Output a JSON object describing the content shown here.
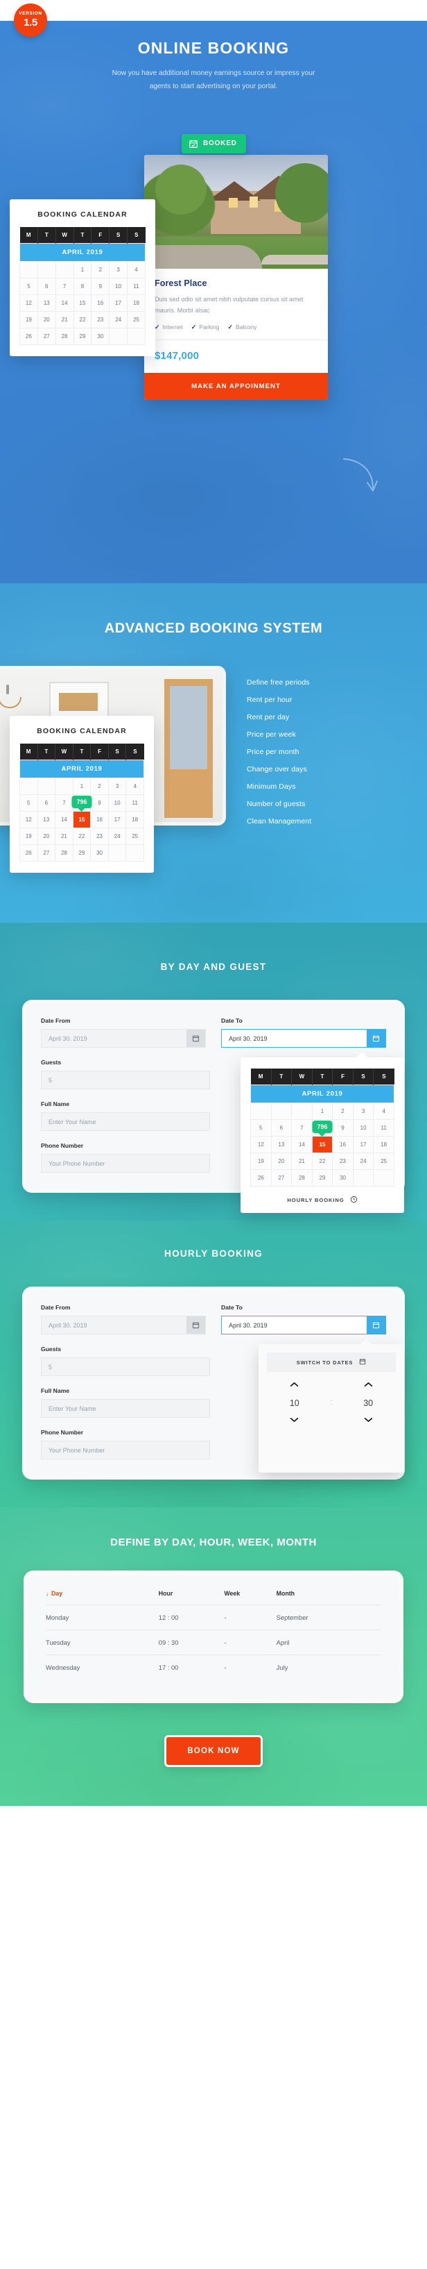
{
  "badge": {
    "label": "VERSION",
    "number": "1.5"
  },
  "hero": {
    "title": "ONLINE BOOKING",
    "subtitle": "Now you have additional money earnings source or impress your agents to start advertising on your portal.",
    "booked_label": "BOOKED",
    "booked_icon": "calendar-check-icon",
    "calendar": {
      "card_title": "BOOKING CALENDAR",
      "month": "APRIL 2019",
      "dow": [
        "M",
        "T",
        "W",
        "T",
        "F",
        "S",
        "S"
      ],
      "weeks": [
        [
          "",
          "",
          "",
          "1",
          "2",
          "3",
          "4"
        ],
        [
          "5",
          "6",
          "7",
          "8",
          "9",
          "10",
          "11"
        ],
        [
          "12",
          "13",
          "14",
          "15",
          "16",
          "17",
          "18"
        ],
        [
          "19",
          "20",
          "21",
          "22",
          "23",
          "24",
          "25"
        ],
        [
          "26",
          "27",
          "28",
          "29",
          "30",
          "",
          ""
        ]
      ]
    },
    "property": {
      "title": "Forest Place",
      "description": "Duis sed odio sit amet nibh vulputate cursus sit amet mauris. Morbi alsac",
      "features": [
        "Internet",
        "Parking",
        "Balcony"
      ],
      "price": "$147,000",
      "cta": "MAKE AN APPOINMENT"
    }
  },
  "advanced": {
    "title": "ADVANCED BOOKING SYSTEM",
    "features": [
      "Define free periods",
      "Rent per hour",
      "Rent per day",
      "Price per week",
      "Price per month",
      "Change over days",
      "Minimum Days",
      "Number of guests",
      "Clean Management"
    ],
    "calendar": {
      "card_title": "BOOKING CALENDAR",
      "month": "APRIL 2019",
      "dow": [
        "M",
        "T",
        "W",
        "T",
        "F",
        "S",
        "S"
      ],
      "weeks": [
        [
          "",
          "",
          "",
          "1",
          "2",
          "3",
          "4"
        ],
        [
          "5",
          "6",
          "7",
          "8",
          "9",
          "10",
          "11"
        ],
        [
          "12",
          "13",
          "14",
          "15",
          "16",
          "17",
          "18"
        ],
        [
          "19",
          "20",
          "21",
          "22",
          "23",
          "24",
          "25"
        ],
        [
          "26",
          "27",
          "28",
          "29",
          "30",
          "",
          ""
        ]
      ],
      "selected_day": "15",
      "price_bubble": "796"
    }
  },
  "byday": {
    "title": "BY DAY AND GUEST",
    "fields": {
      "date_from_label": "Date From",
      "date_from_value": "April 30. 2019",
      "date_to_label": "Date To",
      "date_to_value": "April 30. 2019",
      "guests_label": "Guests",
      "guests_value": "5",
      "fullname_label": "Full Name",
      "fullname_placeholder": "Enter Your Name",
      "phone_label": "Phone Number",
      "phone_placeholder": "Your Phone Number"
    },
    "calendar": {
      "month": "APRIL 2019",
      "dow": [
        "M",
        "T",
        "W",
        "T",
        "F",
        "S",
        "S"
      ],
      "weeks": [
        [
          "",
          "",
          "",
          "1",
          "2",
          "3",
          "4"
        ],
        [
          "5",
          "6",
          "7",
          "8",
          "9",
          "10",
          "11"
        ],
        [
          "12",
          "13",
          "14",
          "15",
          "16",
          "17",
          "18"
        ],
        [
          "19",
          "20",
          "21",
          "22",
          "23",
          "24",
          "25"
        ],
        [
          "26",
          "27",
          "28",
          "29",
          "30",
          "",
          ""
        ]
      ],
      "selected_day": "15",
      "price_bubble": "796",
      "footer_label": "HOURLY BOOKING",
      "footer_icon": "clock-icon"
    }
  },
  "hourly": {
    "title": "HOURLY BOOKING",
    "fields": {
      "date_from_label": "Date From",
      "date_from_value": "April 30. 2019",
      "date_to_label": "Date To",
      "date_to_value": "April 30. 2019",
      "guests_label": "Guests",
      "guests_value": "5",
      "fullname_label": "Full Name",
      "fullname_placeholder": "Enter Your Name",
      "phone_label": "Phone Number",
      "phone_placeholder": "Your Phone Number"
    },
    "picker": {
      "switch_label": "SWITCH TO DATES",
      "switch_icon": "calendar-icon",
      "hours": "10",
      "separator": ":",
      "minutes": "30",
      "up_icon": "chevron-up-icon",
      "down_icon": "chevron-down-icon"
    }
  },
  "define": {
    "title": "DEFINE BY DAY, HOUR, WEEK, MONTH",
    "table": {
      "columns": [
        "Day",
        "Hour",
        "Week",
        "Month"
      ],
      "sorted_column": "Day",
      "sort_icon": "arrow-down-icon",
      "rows": [
        [
          "Monday",
          "12 : 00",
          "-",
          "September"
        ],
        [
          "Tuesday",
          "09 : 30",
          "-",
          "April"
        ],
        [
          "Wednesday",
          "17 : 00",
          "-",
          "July"
        ]
      ]
    },
    "cta": "BOOK NOW"
  },
  "colors": {
    "accent_orange": "#f1400d",
    "accent_blue": "#3aaee8",
    "accent_green": "#17c57f",
    "hero_blue": "#3b86d4",
    "teal": "#35a8b6",
    "green": "#4bc79b"
  }
}
